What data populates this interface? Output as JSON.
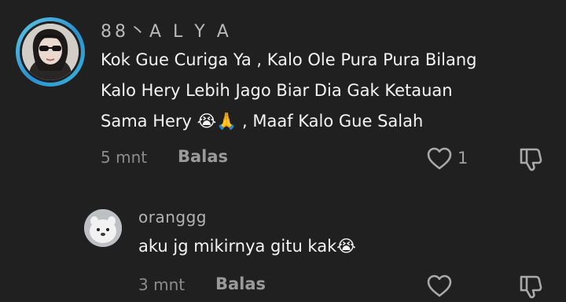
{
  "comments": [
    {
      "username": "88丶A L Y A",
      "lines": [
        "Kok Gue Curiga Ya , Kalo Ole Pura Pura Bilang",
        "Kalo Hery Lebih Jago Biar Dia Gak Ketauan",
        "Sama Hery 😭🙏 , Maaf Kalo Gue Salah"
      ],
      "time": "5 mnt",
      "reply_label": "Balas",
      "like_count": "1"
    },
    {
      "username": "oranggg",
      "text": "aku jg mikirnya gitu kak😭",
      "time": "3 mnt",
      "reply_label": "Balas"
    }
  ],
  "icons": {
    "like": "heart-outline-icon",
    "dislike": "thumbs-down-outline-icon"
  },
  "colors": {
    "background": "#202020",
    "avatar_ring": "#2a8fd0",
    "text_primary": "#f4f4f4",
    "text_muted": "#8c8c8c"
  }
}
